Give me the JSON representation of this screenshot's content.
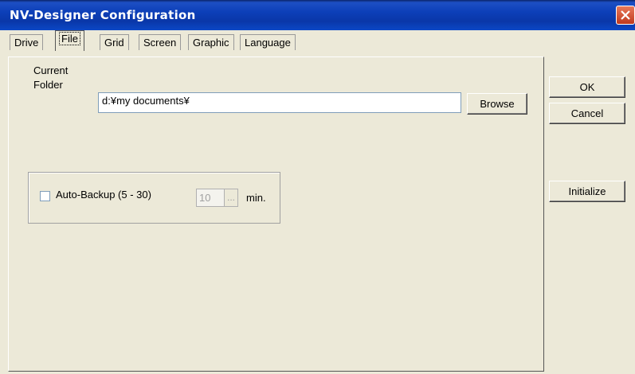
{
  "window": {
    "title": "NV-Designer Configuration"
  },
  "tabs": [
    {
      "label": "Drive",
      "active": false
    },
    {
      "label": "File",
      "active": true
    },
    {
      "label": "Grid",
      "active": false
    },
    {
      "label": "Screen",
      "active": false
    },
    {
      "label": "Graphic",
      "active": false
    },
    {
      "label": "Language",
      "active": false
    }
  ],
  "file": {
    "folder_label_line1": "Current",
    "folder_label_line2": "Folder",
    "folder_value": "d:¥my documents¥",
    "browse_label": "Browse",
    "autobackup_label": "Auto-Backup (5 - 30)",
    "autobackup_checked": false,
    "minutes_value": "10",
    "dots_label": "...",
    "minutes_unit": "min."
  },
  "buttons": {
    "ok": "OK",
    "cancel": "Cancel",
    "initialize": "Initialize"
  },
  "colors": {
    "titlebar": "#0a37a8",
    "face": "#ece9d8",
    "close": "#c0391d"
  },
  "icons": {
    "close": "close-icon"
  }
}
